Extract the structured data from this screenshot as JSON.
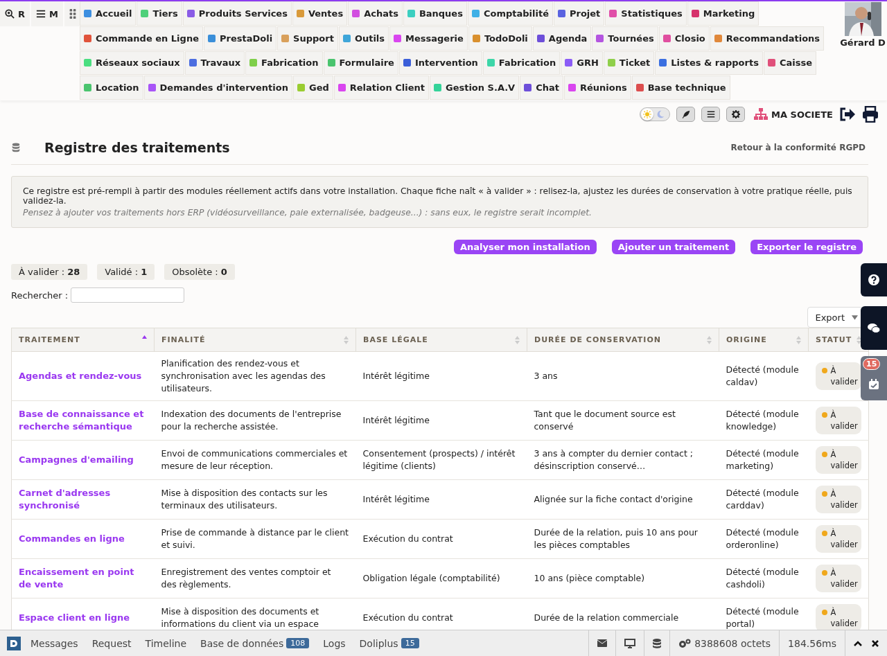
{
  "top_buttons": [
    {
      "label": "R"
    },
    {
      "label": "M"
    }
  ],
  "menu": {
    "rows": [
      {
        "items": [
          {
            "label": "Accueil",
            "color": "#3d8fe0"
          },
          {
            "label": "Tiers",
            "color": "#4fd07a"
          },
          {
            "label": "Produits Services",
            "color": "#8a5ce6"
          },
          {
            "label": "Ventes",
            "color": "#d99a3a"
          },
          {
            "label": "Achats",
            "color": "#d24fe0"
          },
          {
            "label": "Banques",
            "color": "#3ccfc0"
          },
          {
            "label": "Comptabilité",
            "color": "#3fb0e6"
          },
          {
            "label": "Projet",
            "color": "#5a63e0"
          },
          {
            "label": "Statistiques",
            "color": "#e04fa8"
          },
          {
            "label": "Marketing",
            "color": "#d6336c"
          }
        ]
      },
      {
        "items": [
          {
            "label": "Commande en Ligne",
            "color": "#e0533b"
          },
          {
            "label": "PrestaDoli",
            "color": "#3b8fd9"
          },
          {
            "label": "Support",
            "color": "#d9a05b"
          },
          {
            "label": "Outils",
            "color": "#3fa6d9"
          },
          {
            "label": "Messagerie",
            "color": "#d946ef"
          },
          {
            "label": "TodoDoli",
            "color": "#d9902e"
          },
          {
            "label": "Agenda",
            "color": "#6d4fd9"
          },
          {
            "label": "Tournées",
            "color": "#b455e0"
          },
          {
            "label": "Closio",
            "color": "#e04fa0"
          },
          {
            "label": "Recommandations",
            "color": "#e0883b"
          }
        ]
      },
      {
        "items": [
          {
            "label": "Réseaux sociaux",
            "color": "#4ade80"
          },
          {
            "label": "Travaux",
            "color": "#4c6ee0"
          },
          {
            "label": "Fabrication",
            "color": "#7fcf4a"
          },
          {
            "label": "Formulaire",
            "color": "#4ac46e"
          },
          {
            "label": "Intervention",
            "color": "#3b5fd9"
          },
          {
            "label": "Fabrication",
            "color": "#3dd6a8"
          },
          {
            "label": "GRH",
            "color": "#8b5cf6"
          },
          {
            "label": "Ticket",
            "color": "#8fcf4a"
          },
          {
            "label": "Listes & rapports",
            "color": "#3b6fe0"
          },
          {
            "label": "Caisse",
            "color": "#e0507a"
          }
        ]
      },
      {
        "items": [
          {
            "label": "Location",
            "color": "#4ac46e"
          },
          {
            "label": "Demandes d'intervention",
            "color": "#a855f7"
          },
          {
            "label": "Ged",
            "color": "#9acd32"
          },
          {
            "label": "Relation Client",
            "color": "#d946ef"
          },
          {
            "label": "Gestion S.A.V",
            "color": "#34d399"
          },
          {
            "label": "Chat",
            "color": "#6d4fd9"
          },
          {
            "label": "Réunions",
            "color": "#d946ef"
          },
          {
            "label": "Base technique",
            "color": "#dc4e4e"
          }
        ]
      }
    ]
  },
  "user": {
    "name": "Gérard D"
  },
  "toolbar": {
    "dark_mode": false,
    "company": "MA SOCIETE"
  },
  "page": {
    "title": "Registre des traitements",
    "back_link": "Retour à la conformité RGPD"
  },
  "info": {
    "text": "Ce registre est pré-rempli à partir des modules réellement actifs dans votre installation. Chaque fiche naît « à valider » : relisez-la, ajustez les durées de conservation à votre pratique réelle, puis validez-la.",
    "hint": "Pensez à ajouter vos traitements hors ERP (vidéosurveillance, paie externalisée, badgeuse...) : sans eux, le registre serait incomplet."
  },
  "actions": [
    "Analyser mon installation",
    "Ajouter un traitement",
    "Exporter le registre"
  ],
  "counters": [
    {
      "label": "À valider :",
      "count": "28"
    },
    {
      "label": "Validé :",
      "count": "1"
    },
    {
      "label": "Obsolète :",
      "count": "0"
    }
  ],
  "search": {
    "label": "Rechercher :"
  },
  "export": {
    "label": "Export"
  },
  "table": {
    "columns": [
      {
        "label": "TRAITEMENT",
        "sorted": true
      },
      {
        "label": "FINALITÉ",
        "sorted": false
      },
      {
        "label": "BASE LÉGALE",
        "sorted": false
      },
      {
        "label": "DURÉE DE CONSERVATION",
        "sorted": false
      },
      {
        "label": "ORIGINE",
        "sorted": false
      },
      {
        "label": "STATUT",
        "sorted": false
      }
    ],
    "rows": [
      {
        "name": "Agendas et rendez-vous",
        "purpose": "Planification des rendez-vous et synchronisation avec les agendas des utilisateurs.",
        "basis": "Intérêt légitime",
        "retention": "3 ans",
        "origin": "Détecté (module caldav)",
        "status": {
          "label": "À valider",
          "color": "#f0a81c"
        }
      },
      {
        "name": "Base de connaissance et recherche sémantique",
        "purpose": "Indexation des documents de l'entreprise pour la recherche assistée.",
        "basis": "Intérêt légitime",
        "retention": "Tant que le document source est conservé",
        "origin": "Détecté (module knowledge)",
        "status": {
          "label": "À valider",
          "color": "#f0a81c"
        }
      },
      {
        "name": "Campagnes d'emailing",
        "purpose": "Envoi de communications commerciales et mesure de leur réception.",
        "basis": "Consentement (prospects) / intérêt légitime (clients)",
        "retention": "3 ans à compter du dernier contact ; désinscription conservé…",
        "origin": "Détecté (module marketing)",
        "status": {
          "label": "À valider",
          "color": "#f0a81c"
        }
      },
      {
        "name": "Carnet d'adresses synchronisé",
        "purpose": "Mise à disposition des contacts sur les terminaux des utilisateurs.",
        "basis": "Intérêt légitime",
        "retention": "Alignée sur la fiche contact d'origine",
        "origin": "Détecté (module carddav)",
        "status": {
          "label": "À valider",
          "color": "#f0a81c"
        }
      },
      {
        "name": "Commandes en ligne",
        "purpose": "Prise de commande à distance par le client et suivi.",
        "basis": "Exécution du contrat",
        "retention": "Durée de la relation, puis 10 ans pour les pièces comptables",
        "origin": "Détecté (module orderonline)",
        "status": {
          "label": "À valider",
          "color": "#f0a81c"
        }
      },
      {
        "name": "Encaissement en point de vente",
        "purpose": "Enregistrement des ventes comptoir et des règlements.",
        "basis": "Obligation légale (comptabilité)",
        "retention": "10 ans (pièce comptable)",
        "origin": "Détecté (module cashdoli)",
        "status": {
          "label": "À valider",
          "color": "#f0a81c"
        }
      },
      {
        "name": "Espace client en ligne",
        "purpose": "Mise à disposition des documents et informations du client via un espace",
        "basis": "Exécution du contrat",
        "retention": "Durée de la relation commerciale",
        "origin": "Détecté (module portal)",
        "status": {
          "label": "À valider",
          "color": "#f0a81c"
        }
      }
    ]
  },
  "side_tabs": {
    "agenda_badge": "15"
  },
  "debug_bar": {
    "tabs": [
      {
        "label": "Messages"
      },
      {
        "label": "Request"
      },
      {
        "label": "Timeline"
      },
      {
        "label": "Base de données",
        "badge": "108"
      },
      {
        "label": "Logs"
      },
      {
        "label": "Doliplus",
        "badge": "15"
      }
    ],
    "memory": "8388608 octets",
    "time": "184.56ms"
  }
}
